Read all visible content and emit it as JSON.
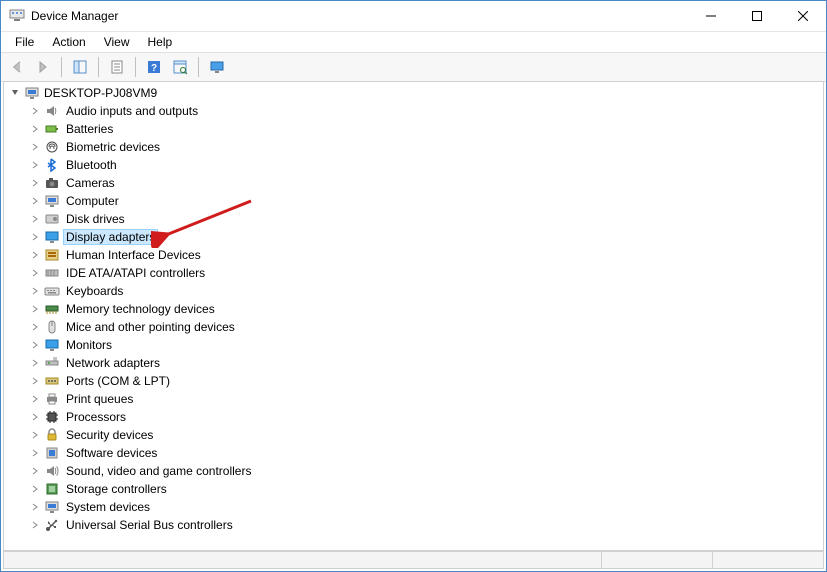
{
  "window": {
    "title": "Device Manager"
  },
  "menu": {
    "file": "File",
    "action": "Action",
    "view": "View",
    "help": "Help"
  },
  "tree": {
    "root": {
      "label": "DESKTOP-PJ08VM9",
      "expanded": true
    },
    "items": [
      {
        "label": "Audio inputs and outputs",
        "icon": "speaker"
      },
      {
        "label": "Batteries",
        "icon": "battery"
      },
      {
        "label": "Biometric devices",
        "icon": "biometric"
      },
      {
        "label": "Bluetooth",
        "icon": "bluetooth"
      },
      {
        "label": "Cameras",
        "icon": "camera"
      },
      {
        "label": "Computer",
        "icon": "computer"
      },
      {
        "label": "Disk drives",
        "icon": "disk"
      },
      {
        "label": "Display adapters",
        "icon": "display",
        "selected": true
      },
      {
        "label": "Human Interface Devices",
        "icon": "hid"
      },
      {
        "label": "IDE ATA/ATAPI controllers",
        "icon": "ide"
      },
      {
        "label": "Keyboards",
        "icon": "keyboard"
      },
      {
        "label": "Memory technology devices",
        "icon": "memory"
      },
      {
        "label": "Mice and other pointing devices",
        "icon": "mouse"
      },
      {
        "label": "Monitors",
        "icon": "monitor"
      },
      {
        "label": "Network adapters",
        "icon": "network"
      },
      {
        "label": "Ports (COM & LPT)",
        "icon": "port"
      },
      {
        "label": "Print queues",
        "icon": "printer"
      },
      {
        "label": "Processors",
        "icon": "cpu"
      },
      {
        "label": "Security devices",
        "icon": "security"
      },
      {
        "label": "Software devices",
        "icon": "software"
      },
      {
        "label": "Sound, video and game controllers",
        "icon": "sound"
      },
      {
        "label": "Storage controllers",
        "icon": "storage"
      },
      {
        "label": "System devices",
        "icon": "system"
      },
      {
        "label": "Universal Serial Bus controllers",
        "icon": "usb"
      }
    ]
  },
  "annotation": {
    "color": "#d01c1c"
  }
}
